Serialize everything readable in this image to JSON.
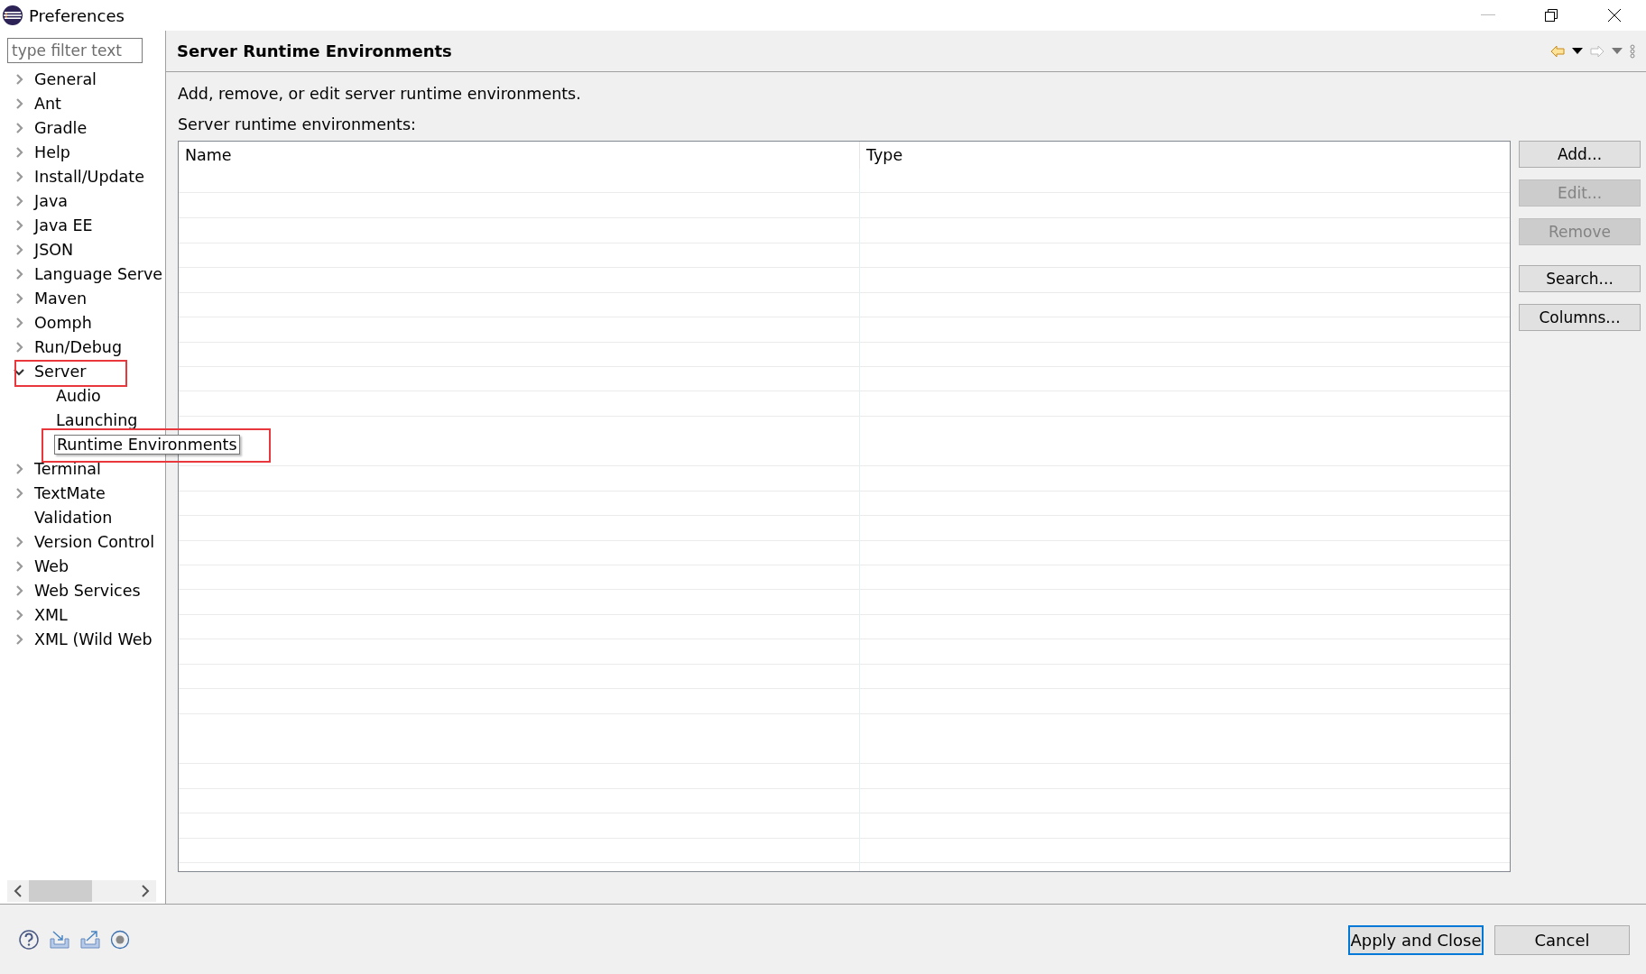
{
  "window": {
    "title": "Preferences"
  },
  "filter": {
    "placeholder": "type filter text"
  },
  "tree": [
    {
      "label": "General",
      "kind": "node",
      "expanded": false,
      "highlight": false
    },
    {
      "label": "Ant",
      "kind": "node",
      "expanded": false,
      "highlight": false
    },
    {
      "label": "Gradle",
      "kind": "node",
      "expanded": false,
      "highlight": false
    },
    {
      "label": "Help",
      "kind": "node",
      "expanded": false,
      "highlight": false
    },
    {
      "label": "Install/Update",
      "kind": "node",
      "expanded": false,
      "highlight": false
    },
    {
      "label": "Java",
      "kind": "node",
      "expanded": false,
      "highlight": false
    },
    {
      "label": "Java EE",
      "kind": "node",
      "expanded": false,
      "highlight": false
    },
    {
      "label": "JSON",
      "kind": "node",
      "expanded": false,
      "highlight": false
    },
    {
      "label": "Language Serve",
      "kind": "node",
      "expanded": false,
      "highlight": false
    },
    {
      "label": "Maven",
      "kind": "node",
      "expanded": false,
      "highlight": false
    },
    {
      "label": "Oomph",
      "kind": "node",
      "expanded": false,
      "highlight": false
    },
    {
      "label": "Run/Debug",
      "kind": "node",
      "expanded": false,
      "highlight": false
    },
    {
      "label": "Server",
      "kind": "node",
      "expanded": true,
      "highlight": true,
      "children": [
        {
          "label": "Audio",
          "kind": "leaf",
          "highlight": false
        },
        {
          "label": "Launching",
          "kind": "leaf",
          "highlight": false
        },
        {
          "label": "Runtime Environments",
          "kind": "leaf",
          "highlight": true,
          "tooltip": true
        }
      ]
    },
    {
      "label": "Terminal",
      "kind": "node",
      "expanded": false,
      "highlight": false
    },
    {
      "label": "TextMate",
      "kind": "node",
      "expanded": false,
      "highlight": false
    },
    {
      "label": "Validation",
      "kind": "leaf",
      "highlight": false
    },
    {
      "label": "Version Control",
      "kind": "node",
      "expanded": false,
      "highlight": false
    },
    {
      "label": "Web",
      "kind": "node",
      "expanded": false,
      "highlight": false
    },
    {
      "label": "Web Services",
      "kind": "node",
      "expanded": false,
      "highlight": false
    },
    {
      "label": "XML",
      "kind": "node",
      "expanded": false,
      "highlight": false
    },
    {
      "label": "XML (Wild Web",
      "kind": "node",
      "expanded": false,
      "highlight": false
    }
  ],
  "page": {
    "title": "Server Runtime Environments",
    "description": "Add, remove, or edit server runtime environments.",
    "table_label": "Server runtime environments:",
    "table": {
      "columns": [
        "Name",
        "Type"
      ]
    },
    "button_groups": [
      {
        "buttons": [
          {
            "label": "Add...",
            "disabled": false
          },
          {
            "label": "Edit...",
            "disabled": true
          },
          {
            "label": "Remove",
            "disabled": true
          }
        ]
      },
      {
        "buttons": [
          {
            "label": "Search...",
            "disabled": false
          },
          {
            "label": "Columns...",
            "disabled": false
          }
        ]
      }
    ]
  },
  "footer_buttons": [
    {
      "label": "Apply and Close",
      "default": true
    },
    {
      "label": "Cancel",
      "default": false
    }
  ]
}
